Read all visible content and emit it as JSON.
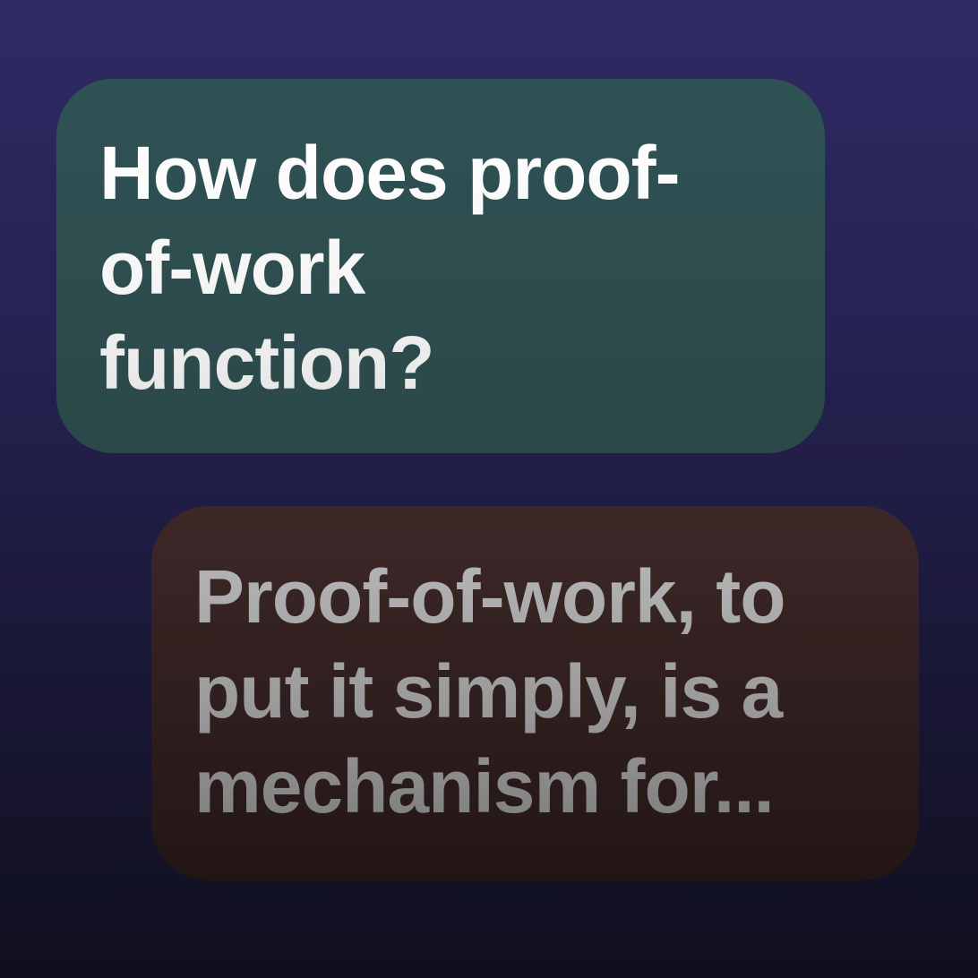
{
  "conversation": {
    "question": {
      "lines": [
        "How does proof-",
        "of-work",
        "function?"
      ]
    },
    "answer": {
      "lines": [
        "Proof-of-work, to",
        "put it simply, is a",
        "mechanism for..."
      ]
    }
  },
  "colors": {
    "background_top": "#2f2a64",
    "background_bottom": "#0f0f1e",
    "question_bubble": "#2f5255",
    "answer_bubble": "#3d2828",
    "question_text": "#ffffff",
    "answer_text": "#9a9a9a"
  }
}
